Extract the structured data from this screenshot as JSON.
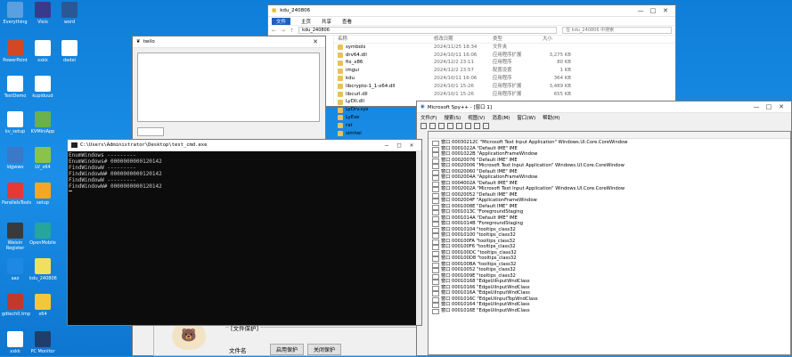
{
  "desktop_icons": [
    {
      "label": "Everything",
      "icon": "search-icon",
      "color": "#5aa0e0"
    },
    {
      "label": "Visio",
      "icon": "app-icon",
      "color": "#3a3a8a"
    },
    {
      "label": "word",
      "icon": "doc-icon",
      "color": "#2b5797"
    },
    {
      "label": "PowerPoint",
      "icon": "doc-icon",
      "color": "#d24726"
    },
    {
      "label": "xxkk",
      "icon": "doc-icon",
      "color": "#ffffff"
    },
    {
      "label": "dedel",
      "icon": "doc-icon",
      "color": "#ffffff"
    },
    {
      "label": "TestDemo",
      "icon": "app-icon",
      "color": "#ffffff"
    },
    {
      "label": "kupiduud",
      "icon": "app-icon",
      "color": "#ffffff"
    },
    {
      "label": "kv_setup",
      "icon": "app-icon",
      "color": "#ffffff"
    },
    {
      "label": "KVMiniApp",
      "icon": "app-icon",
      "color": "#6ab04c"
    },
    {
      "label": "ldgwwo",
      "icon": "app-icon",
      "color": "#3b78c8"
    },
    {
      "label": "LV_x64",
      "icon": "doc-icon",
      "color": "#8bc34a"
    },
    {
      "label": "ParallelsTools",
      "icon": "app-icon",
      "color": "#e53935"
    },
    {
      "label": "setup",
      "icon": "app-icon",
      "color": "#f5a623"
    },
    {
      "label": "Weixin Register",
      "icon": "app-icon",
      "color": "#3a3a3a"
    },
    {
      "label": "OpenMobile",
      "icon": "app-icon",
      "color": "#26a69a"
    },
    {
      "label": "aaz",
      "icon": "app-icon",
      "color": "#1e88e5"
    },
    {
      "label": "kdu_240806",
      "icon": "doc-icon",
      "color": "#f0e060"
    },
    {
      "label": "gdtech0.tmp",
      "icon": "app-icon",
      "color": "#c0392b"
    },
    {
      "label": "x64",
      "icon": "folder-icon",
      "color": "#f3c73a"
    },
    {
      "label": "xxkk",
      "icon": "app-icon",
      "color": "#ffffff"
    },
    {
      "label": "PC Monitor",
      "icon": "monitor-icon",
      "color": "#1f3f6a"
    }
  ],
  "explorer": {
    "title": "kdu_240806",
    "ribbon_tabs": [
      "文件",
      "主页",
      "共享",
      "查看"
    ],
    "address": "kdu_240806",
    "search_placeholder": "在 kdu_240806 中搜索",
    "col_name": "名称",
    "col_date": "修改日期",
    "col_type": "类型",
    "col_size": "大小",
    "rows": [
      {
        "name": "symbols",
        "date": "2024/11/25 18:34",
        "type": "文件夹",
        "size": ""
      },
      {
        "name": "drv64.dll",
        "date": "2024/10/11 16:06",
        "type": "应用程序扩展",
        "size": "3,275 KB"
      },
      {
        "name": "fix_x86",
        "date": "2024/12/2 23:11",
        "type": "应用程序",
        "size": "80 KB"
      },
      {
        "name": "imgui",
        "date": "2024/12/2 23:57",
        "type": "配置设置",
        "size": "1 KB"
      },
      {
        "name": "kdu",
        "date": "2024/10/11 16:06",
        "type": "应用程序",
        "size": "364 KB"
      },
      {
        "name": "libcrypto-1_1-x64.dll",
        "date": "2024/10/1 15:26",
        "type": "应用程序扩展",
        "size": "3,489 KB"
      },
      {
        "name": "libcurl.dll",
        "date": "2024/10/1 15:26",
        "type": "应用程序扩展",
        "size": "655 KB"
      },
      {
        "name": "LyDll.dll",
        "date": "",
        "type": "",
        "size": ""
      },
      {
        "name": "LyDrv.sys",
        "date": "",
        "type": "",
        "size": ""
      },
      {
        "name": "LyExe",
        "date": "",
        "type": "",
        "size": ""
      },
      {
        "name": "rat",
        "date": "",
        "type": "",
        "size": ""
      },
      {
        "name": "simhei",
        "date": "",
        "type": "",
        "size": ""
      }
    ]
  },
  "twilio": {
    "title": "twilo"
  },
  "cmd": {
    "title": "C:\\Users\\Administrator\\Desktop\\test_cmd.exe",
    "lines": [
      "EnumWindows ---------",
      "EnumWindows# 0000000000120142",
      "FindWindowW ---------",
      "FindWindowW# 0000000000120142",
      "FindWindowW ---------",
      "FindWindowW# 0000000000120142"
    ]
  },
  "spy": {
    "title": "Microsoft Spy++ - [窗口 1]",
    "menu": [
      "文件(F)",
      "搜索(S)",
      "视图(V)",
      "消息(M)",
      "窗口(W)",
      "帮助(H)"
    ],
    "rows": [
      "窗口 00030212C \"Microsoft Text Input Application\" Windows.UI.Core.CoreWindow",
      "窗口 0001022A \"Default IME\" IME",
      "窗口 0001022B \"ApplicationFrameWindow",
      "窗口 00020076 \"Default IME\" IME",
      "窗口 00020006 \"Microsoft Text Input Application\" Windows.UI.Core.CoreWindow",
      "窗口 00020060 \"Default IME\" IME",
      "窗口 0002004A \"ApplicationFrameWindow",
      "窗口 0004002A \"Default IME\" IME",
      "窗口 0002002A \"Microsoft Text Input Application\" Windows.UI.Core.CoreWindow",
      "窗口 00020052 \"Default IME\" IME",
      "窗口 0002004F \"ApplicationFrameWindow",
      "窗口 0001008E \"Default IME\" IME",
      "窗口 0001013C \"ForegroundStaging",
      "窗口 0001014A \"Default IME\" IME",
      "窗口 0001014B \"ForegroundStaging",
      "窗口 00010104 \"tooltips_class32",
      "窗口 00010100 \"tooltips_class32",
      "窗口 000100FA \"tooltips_class32",
      "窗口 000100F6 \"tooltips_class32",
      "窗口 000100DC \"tooltips_class32",
      "窗口 000100D8 \"tooltips_class32",
      "窗口 000100BA \"tooltips_class32",
      "窗口 00010052 \"tooltips_class32",
      "窗口 0001009E \"tooltips_class32",
      "窗口 00010168 \"EdgeUiInputWndClass",
      "窗口 00010166 \"EdgeUiInputWndClass",
      "窗口 0001016A \"EdgeUiInputWndClass",
      "窗口 0001016C \"EdgeUiInputTopWndClass",
      "窗口 00010164 \"EdgeUiInputWndClass",
      "窗口 0001016E \"EdgeUiInputWndClass"
    ]
  },
  "lower": {
    "section_label": "[文件保护]",
    "field_label": "文件名",
    "btn_open": "启用保护",
    "btn_close": "关闭保护"
  }
}
